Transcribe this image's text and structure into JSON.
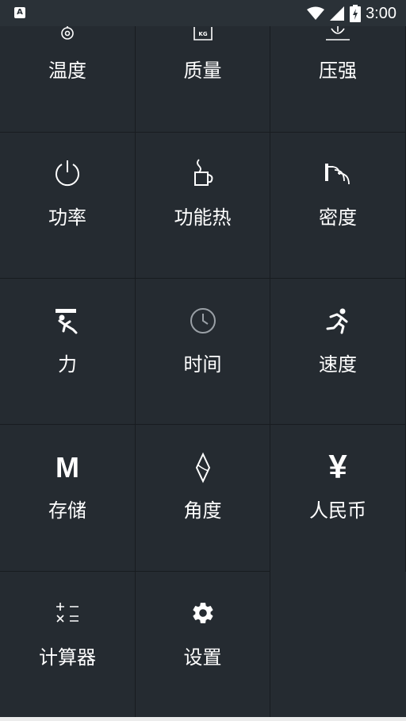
{
  "status_bar": {
    "app_badge": "A",
    "time": "3:00",
    "icons": [
      "wifi-icon",
      "signal-icon",
      "battery-charging-icon"
    ]
  },
  "colors": {
    "background": "#252b31",
    "divider": "#181c20",
    "text": "#ffffff"
  },
  "grid": {
    "items": [
      {
        "label": "温度",
        "icon": "thermometer-icon"
      },
      {
        "label": "质量",
        "icon": "weight-icon"
      },
      {
        "label": "压强",
        "icon": "pressure-icon"
      },
      {
        "label": "功率",
        "icon": "power-icon"
      },
      {
        "label": "功能热",
        "icon": "coffee-cup-icon"
      },
      {
        "label": "密度",
        "icon": "density-icon"
      },
      {
        "label": "力",
        "icon": "force-icon"
      },
      {
        "label": "时间",
        "icon": "clock-icon"
      },
      {
        "label": "速度",
        "icon": "running-icon"
      },
      {
        "label": "存储",
        "icon": "memory-icon",
        "glyph": "M"
      },
      {
        "label": "角度",
        "icon": "angle-icon"
      },
      {
        "label": "人民币",
        "icon": "yuan-icon",
        "glyph": "¥"
      },
      {
        "label": "计算器",
        "icon": "calculator-icon"
      },
      {
        "label": "设置",
        "icon": "gear-icon"
      }
    ]
  }
}
